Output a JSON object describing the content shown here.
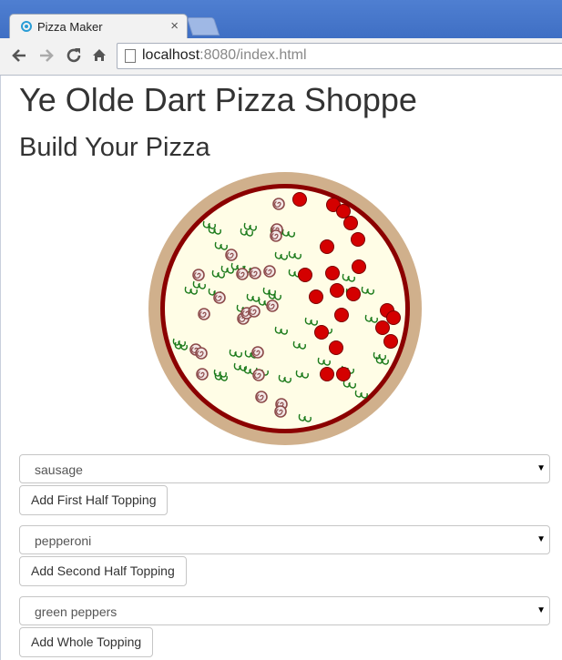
{
  "browser": {
    "tab_title": "Pizza Maker",
    "tab_close": "×",
    "url_host": "localhost",
    "url_rest": ":8080/index.html"
  },
  "page": {
    "title": "Ye Olde Dart Pizza Shoppe",
    "subtitle": "Build Your Pizza"
  },
  "controls": [
    {
      "select_value": "sausage",
      "button_label": "Add First Half Topping"
    },
    {
      "select_value": "pepperoni",
      "button_label": "Add Second Half Topping"
    },
    {
      "select_value": "green peppers",
      "button_label": "Add Whole Topping"
    }
  ],
  "icons": {
    "back": "back-arrow-icon",
    "forward": "forward-arrow-icon",
    "reload": "reload-icon",
    "home": "home-icon",
    "select_caret": "caret-down-icon"
  },
  "colors": {
    "crust": "#d0b08c",
    "sauce": "#8b0000",
    "cheese": "#fffde6",
    "pepperoni": "#d40000",
    "green_pepper": "#1a7a1a",
    "sausage": "#8c4a4a",
    "tabstrip": "#4f7fd1"
  }
}
